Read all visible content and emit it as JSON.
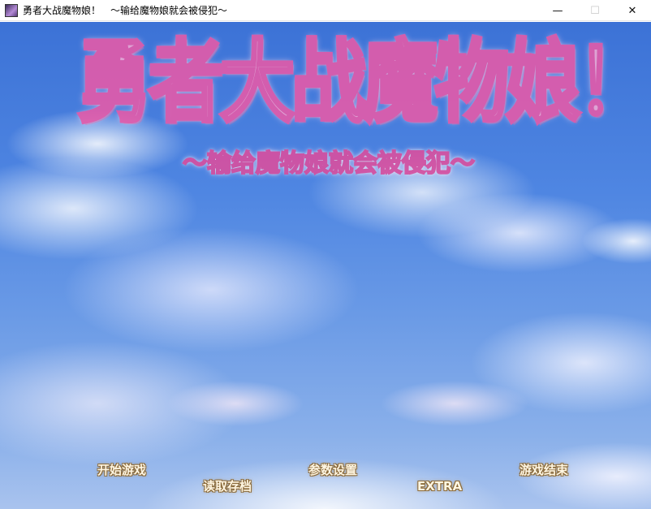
{
  "window": {
    "title": "勇者大战魔物娘！　～输给魔物娘就会被侵犯～",
    "minimize_glyph": "—",
    "maximize_glyph": "☐",
    "close_glyph": "✕",
    "icon": "app-icon"
  },
  "logo": {
    "main_text": "勇者大战魔物娘！",
    "sub_text": "～输给魔物娘就会被侵犯～",
    "colors": {
      "fill": "#f4a9d3",
      "outline": "#e85aa8"
    }
  },
  "menu": {
    "start": "开始游戏",
    "load": "读取存档",
    "config": "参数设置",
    "extra": "EXTRA",
    "exit": "游戏结束",
    "text_color": "#fff6e2",
    "outline_color": "#8a6a3a"
  },
  "background": {
    "description_colors": [
      "#3c72d6",
      "#a9c3ee"
    ]
  }
}
